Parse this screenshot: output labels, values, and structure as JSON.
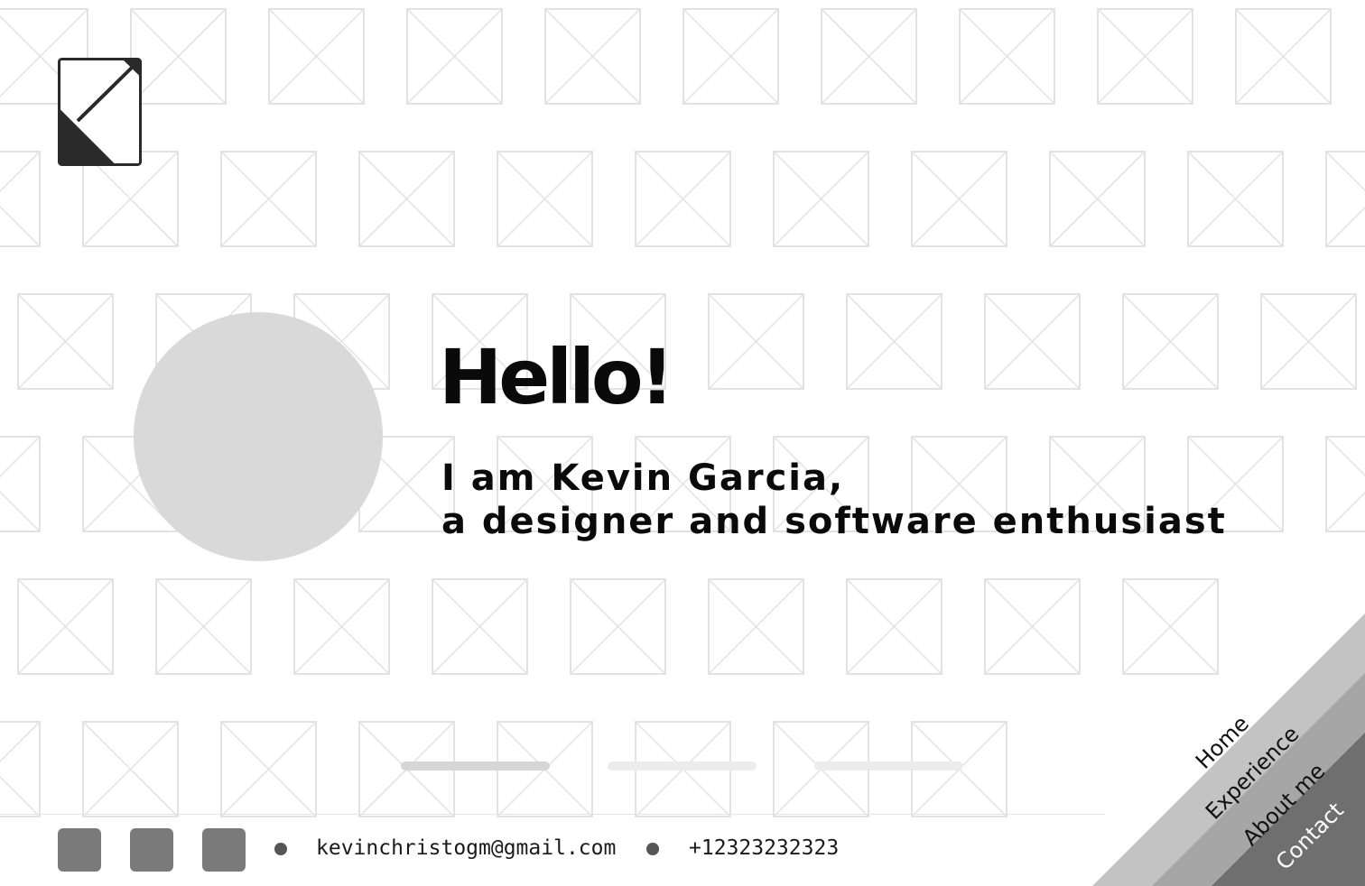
{
  "hero": {
    "greeting": "Hello!",
    "intro_line1": "I am Kevin Garcia,",
    "intro_line2": "a designer and software enthusiast"
  },
  "slider": {
    "slide_count": 3,
    "active_index": 0
  },
  "footer": {
    "social_links": [
      {
        "icon": "social-icon-1"
      },
      {
        "icon": "social-icon-2"
      },
      {
        "icon": "social-icon-3"
      }
    ],
    "email": "kevinchristogm@gmail.com",
    "phone": "+12323232323"
  },
  "nav": {
    "items": [
      {
        "label": "Home"
      },
      {
        "label": "Experience"
      },
      {
        "label": "About me"
      },
      {
        "label": "Contact"
      }
    ]
  },
  "colors": {
    "background": "#ffffff",
    "pattern_stroke": "#e2e2e2",
    "avatar": "#d9d9d9",
    "social_button": "#7a7a7a",
    "corner_light": "#c3c3c3",
    "corner_mid": "#a6a6a6",
    "corner_dark": "#6f6f6f"
  }
}
